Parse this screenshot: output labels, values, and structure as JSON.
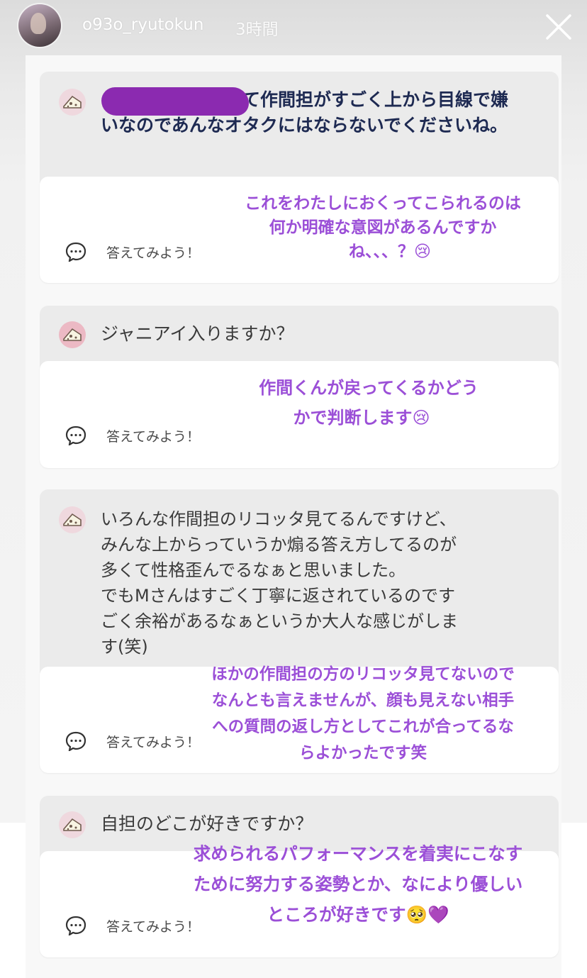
{
  "header": {
    "username": "o93o_ryutokun",
    "time": "3時間"
  },
  "answer_placeholder": "答えてみよう！",
  "cards": [
    {
      "question": "て作間担がすごく上から目線で嫌いなのであんなオタクにはならないでくださいね。",
      "reply_lines": [
        "これをわたしにおくってこられるのは",
        "何か明確な意図があるんですか",
        "ね、、、？😢"
      ]
    },
    {
      "question": "ジャニアイ入りますか？",
      "reply_lines": [
        "作間くんが戻ってくるかどう",
        "かで判断します😢"
      ]
    },
    {
      "question_lines": [
        "いろんな作間担のリコッタ見てるんですけど、",
        "みんな上からっていうか煽る答え方してるのが",
        "多くて性格歪んでるなぁと思いました。",
        "でもMさんはすごく丁寧に返されているのです",
        "ごく余裕があるなぁというか大人な感じがしま",
        "す(笑)"
      ],
      "reply_lines": [
        "ほかの作間担の方のリコッタ見てないので",
        "なんとも言えませんが、顔も見えない相手",
        "への質問の返し方としてこれが合ってるな",
        "らよかったです笑"
      ]
    },
    {
      "question": "自担のどこが好きですか？",
      "reply_lines": [
        "求められるパフォーマンスを着実にこなす",
        "ために努力する姿勢とか、なにより優しい",
        "ところが好きです🥺💜"
      ]
    }
  ],
  "colors": {
    "reply_purple": "#9b4fd7",
    "redaction_purple": "#8b2ab0",
    "question_dark": "#1e2a52"
  },
  "icons": [
    "close-icon",
    "cheese-icon",
    "chat-bubble-icon"
  ]
}
